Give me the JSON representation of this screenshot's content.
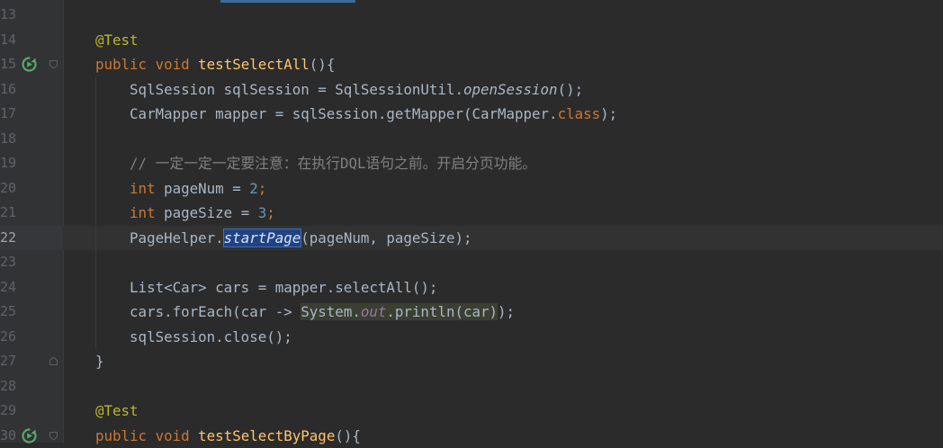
{
  "editor": {
    "theme_colors": {
      "background": "#2b2b2b",
      "keyword": "#cc7832",
      "annotation": "#bbb529",
      "method_decl": "#ffc66d",
      "number": "#6897bb",
      "comment": "#808080",
      "field": "#9876aa",
      "selection": "#214283"
    },
    "current_line": "22",
    "lines": [
      {
        "num": "13",
        "tokens": []
      },
      {
        "num": "14",
        "tokens": [
          {
            "t": "@Test",
            "c": "an"
          }
        ]
      },
      {
        "num": "15",
        "tokens": [
          {
            "t": "public",
            "c": "kw"
          },
          {
            "t": " "
          },
          {
            "t": "void",
            "c": "kw"
          },
          {
            "t": " "
          },
          {
            "t": "testSelectAll",
            "c": "fn"
          },
          {
            "t": "(){"
          }
        ]
      },
      {
        "num": "16",
        "tokens": [
          {
            "t": "    SqlSession sqlSession = SqlSessionUtil."
          },
          {
            "t": "openSession",
            "c": "st"
          },
          {
            "t": "();"
          }
        ]
      },
      {
        "num": "17",
        "tokens": [
          {
            "t": "    CarMapper mapper = sqlSession.getMapper(CarMapper."
          },
          {
            "t": "class",
            "c": "kw"
          },
          {
            "t": ");"
          }
        ]
      },
      {
        "num": "18",
        "tokens": []
      },
      {
        "num": "19",
        "tokens": [
          {
            "t": "    "
          },
          {
            "t": "// 一定一定一定要注意：在执行DQL语句之前。开启分页功能。",
            "c": "cm"
          }
        ]
      },
      {
        "num": "20",
        "tokens": [
          {
            "t": "    "
          },
          {
            "t": "int",
            "c": "kw"
          },
          {
            "t": " pageNum = "
          },
          {
            "t": "2",
            "c": "nm"
          },
          {
            "t": ";",
            "c": "kw"
          }
        ]
      },
      {
        "num": "21",
        "tokens": [
          {
            "t": "    "
          },
          {
            "t": "int",
            "c": "kw"
          },
          {
            "t": " pageSize = "
          },
          {
            "t": "3",
            "c": "nm"
          },
          {
            "t": ";",
            "c": "kw"
          }
        ]
      },
      {
        "num": "22",
        "tokens": [
          {
            "t": "    PageHelper."
          },
          {
            "t": "startPage",
            "c": "hl-sel"
          },
          {
            "t": "(pageNum, pageSize);"
          }
        ]
      },
      {
        "num": "23",
        "tokens": []
      },
      {
        "num": "24",
        "tokens": [
          {
            "t": "    List<Car> cars = mapper.selectAll();"
          }
        ]
      },
      {
        "num": "25",
        "tokens": [
          {
            "t": "    cars.forEach(car -> "
          },
          {
            "t": "System.",
            "c": "hl-lambda"
          },
          {
            "t": "out",
            "c": "fld hl-lambda"
          },
          {
            "t": ".println(car)",
            "c": "hl-lambda"
          },
          {
            "t": ");"
          }
        ]
      },
      {
        "num": "26",
        "tokens": [
          {
            "t": "    sqlSession.close();"
          }
        ]
      },
      {
        "num": "27",
        "tokens": [
          {
            "t": "}"
          }
        ]
      },
      {
        "num": "28",
        "tokens": []
      },
      {
        "num": "29",
        "tokens": [
          {
            "t": "@Test",
            "c": "an"
          }
        ]
      },
      {
        "num": "30",
        "tokens": [
          {
            "t": "public",
            "c": "kw"
          },
          {
            "t": " "
          },
          {
            "t": "void",
            "c": "kw"
          },
          {
            "t": " "
          },
          {
            "t": "testSelectByPage",
            "c": "fn"
          },
          {
            "t": "(){"
          }
        ]
      }
    ],
    "gutter_icons": [
      {
        "line": "15",
        "icon": "run-test-icon"
      },
      {
        "line": "30",
        "icon": "run-test-icon"
      }
    ],
    "fold_markers": [
      "15",
      "27",
      "30"
    ]
  }
}
